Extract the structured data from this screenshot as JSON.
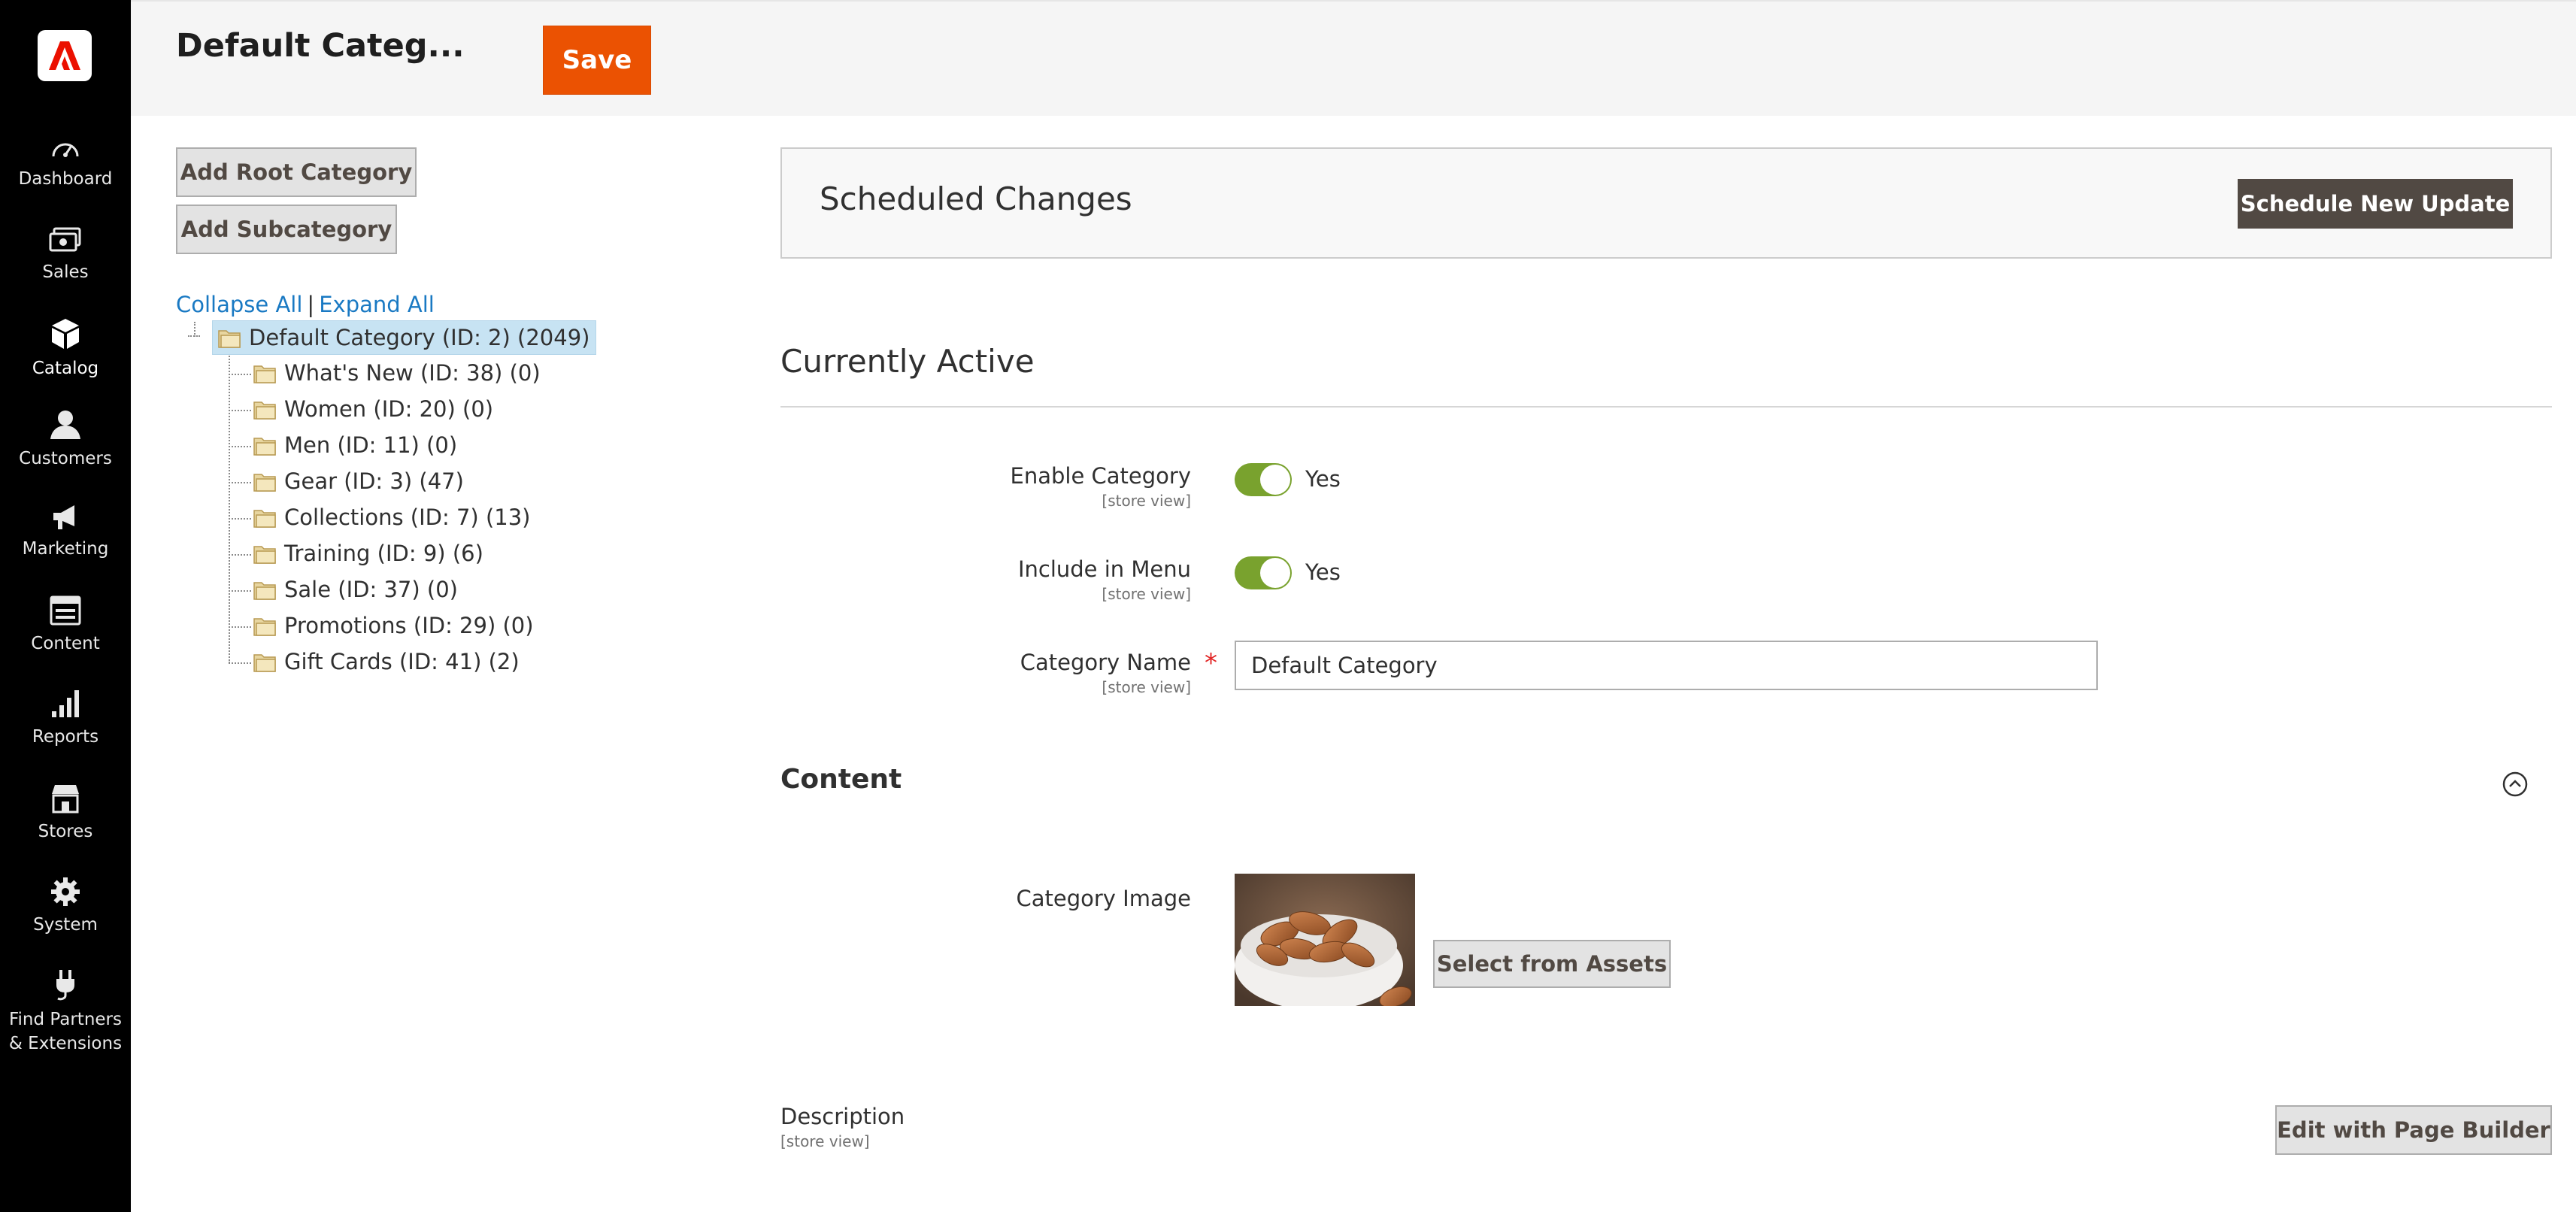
{
  "nav": {
    "items": [
      {
        "label": "Dashboard",
        "icon": "dashboard-icon"
      },
      {
        "label": "Sales",
        "icon": "sales-icon"
      },
      {
        "label": "Catalog",
        "icon": "catalog-icon",
        "active": true
      },
      {
        "label": "Customers",
        "icon": "customers-icon"
      },
      {
        "label": "Marketing",
        "icon": "marketing-icon"
      },
      {
        "label": "Content",
        "icon": "content-icon"
      },
      {
        "label": "Reports",
        "icon": "reports-icon"
      },
      {
        "label": "Stores",
        "icon": "stores-icon"
      },
      {
        "label": "System",
        "icon": "system-icon"
      },
      {
        "label": "Find Partners & Extensions",
        "icon": "extensions-icon"
      }
    ]
  },
  "header": {
    "title": "Default Categ...",
    "save_label": "Save"
  },
  "tree": {
    "add_root_label": "Add Root Category",
    "add_sub_label": "Add Subcategory",
    "collapse_all": "Collapse All",
    "separator": "|",
    "expand_all": "Expand All",
    "root": "Default Category (ID: 2) (2049)",
    "children": [
      "What's New (ID: 38) (0)",
      "Women (ID: 20) (0)",
      "Men (ID: 11) (0)",
      "Gear (ID: 3) (47)",
      "Collections (ID: 7) (13)",
      "Training (ID: 9) (6)",
      "Sale (ID: 37) (0)",
      "Promotions (ID: 29) (0)",
      "Gift Cards (ID: 41) (2)"
    ]
  },
  "scheduled": {
    "title": "Scheduled Changes",
    "button": "Schedule New Update"
  },
  "active": {
    "title": "Currently Active",
    "enable_label": "Enable Category",
    "enable_scope": "[store view]",
    "enable_value": "Yes",
    "menu_label": "Include in Menu",
    "menu_scope": "[store view]",
    "menu_value": "Yes",
    "name_label": "Category Name",
    "name_scope": "[store view]",
    "name_required": "*",
    "name_value": "Default Category"
  },
  "content": {
    "title": "Content",
    "image_label": "Category Image",
    "select_assets": "Select from Assets",
    "description_label": "Description",
    "description_scope": "[store view]",
    "edit_page_builder": "Edit with Page Builder"
  },
  "colors": {
    "accent": "#eb5202",
    "toggle_on": "#79a22e",
    "link": "#1979c3",
    "dark_button": "#514943"
  }
}
